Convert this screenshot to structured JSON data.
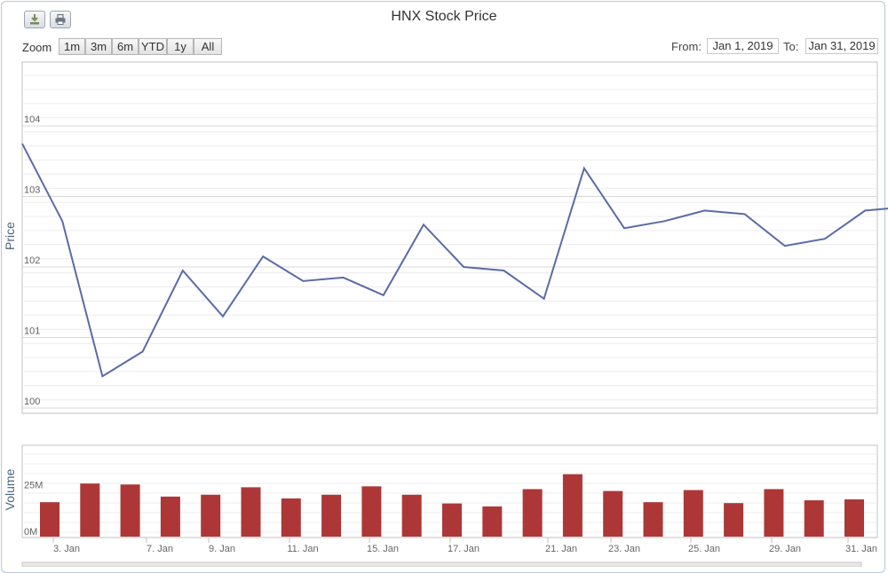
{
  "toolbar": {
    "download_icon": "download-icon",
    "print_icon": "print-icon"
  },
  "title": "HNX Stock Price",
  "range_selector": {
    "zoom_label": "Zoom",
    "buttons": [
      "1m",
      "3m",
      "6m",
      "YTD",
      "1y",
      "All"
    ],
    "from_label": "From:",
    "from_value": "Jan 1, 2019",
    "to_label": "To:",
    "to_value": "Jan 31, 2019"
  },
  "colors": {
    "price_line": "#5b6ba8",
    "volume_bar": "#ad3737",
    "grid": "#d8d8d8",
    "axis_text": "#666666"
  },
  "chart_data": [
    {
      "type": "line",
      "title": "HNX Stock Price",
      "ylabel": "Price",
      "ylim": [
        100,
        105.2
      ],
      "y_ticks": [
        100,
        101,
        102,
        103,
        104
      ],
      "x": [
        "Jan 2",
        "Jan 3",
        "Jan 4",
        "Jan 7",
        "Jan 8",
        "Jan 9",
        "Jan 10",
        "Jan 11",
        "Jan 14",
        "Jan 15",
        "Jan 16",
        "Jan 17",
        "Jan 18",
        "Jan 21",
        "Jan 22",
        "Jan 23",
        "Jan 24",
        "Jan 25",
        "Jan 28",
        "Jan 29",
        "Jan 30",
        "Jan 31"
      ],
      "series": [
        {
          "values": [
            103.75,
            102.65,
            100.45,
            100.8,
            101.95,
            101.3,
            102.15,
            101.8,
            101.85,
            101.6,
            102.6,
            102.0,
            101.95,
            101.55,
            103.4,
            102.55,
            102.65,
            102.8,
            102.75,
            102.3,
            102.4,
            102.8,
            102.85
          ]
        }
      ]
    },
    {
      "type": "bar",
      "ylabel": "Volume",
      "y_ticks": [
        "0M",
        "25M"
      ],
      "ylim_millions": [
        0,
        48
      ],
      "categories": [
        "Jan 2",
        "Jan 3",
        "Jan 4",
        "Jan 7",
        "Jan 8",
        "Jan 9",
        "Jan 10",
        "Jan 11",
        "Jan 14",
        "Jan 15",
        "Jan 16",
        "Jan 17",
        "Jan 18",
        "Jan 21",
        "Jan 22",
        "Jan 23",
        "Jan 24",
        "Jan 25",
        "Jan 28",
        "Jan 29",
        "Jan 30",
        "Jan 31"
      ],
      "values_millions": [
        18.5,
        28.5,
        28,
        21.5,
        22.5,
        26.5,
        20.5,
        22.5,
        27,
        22.5,
        17.8,
        16.2,
        25.5,
        33.5,
        24.5,
        18.5,
        25,
        18,
        25.5,
        19.5,
        20
      ]
    }
  ],
  "x_axis_labels": [
    "3. Jan",
    "7. Jan",
    "9. Jan",
    "11. Jan",
    "15. Jan",
    "17. Jan",
    "21. Jan",
    "23. Jan",
    "25. Jan",
    "29. Jan",
    "31. Jan"
  ]
}
